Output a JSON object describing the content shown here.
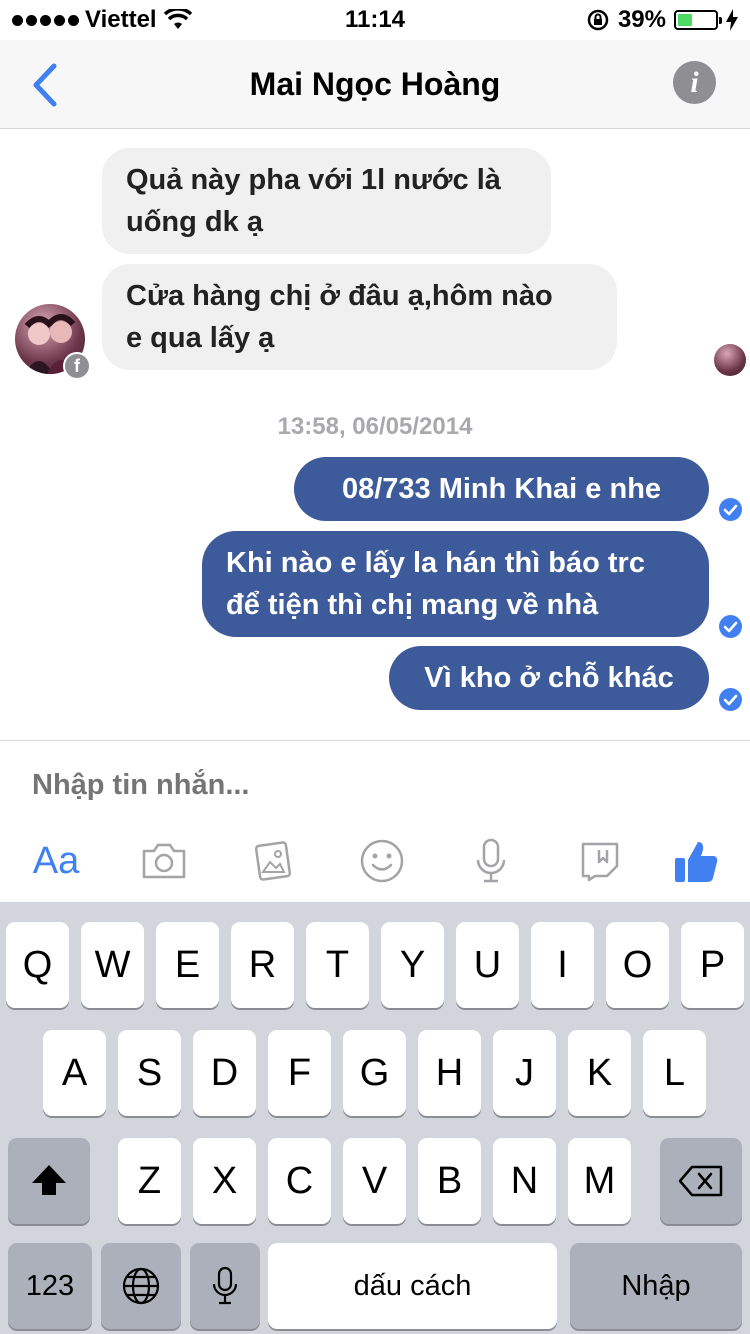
{
  "status_bar": {
    "carrier": "Viettel",
    "time": "11:14",
    "battery_percent": "39%",
    "battery_level": 0.39
  },
  "nav": {
    "title": "Mai Ngọc Hoàng"
  },
  "messages": {
    "incoming": [
      {
        "lines": [
          "Quả này pha với 1l nước là",
          "uống dk ạ"
        ]
      },
      {
        "lines": [
          "Cửa hàng chị ở đâu ạ,hôm nào",
          "e qua lấy ạ"
        ]
      }
    ],
    "timestamp": "13:58, 06/05/2014",
    "outgoing": [
      {
        "lines": [
          "08/733 Minh Khai e nhe"
        ]
      },
      {
        "lines": [
          "Khi nào e lấy la hán thì báo trc",
          "để tiện thì chị mang về nhà"
        ]
      },
      {
        "lines": [
          "Vì kho ở chỗ khác"
        ]
      }
    ]
  },
  "composer": {
    "placeholder": "Nhập tin nhắn...",
    "aa_label": "Aa"
  },
  "keyboard": {
    "row1": [
      "Q",
      "W",
      "E",
      "R",
      "T",
      "Y",
      "U",
      "I",
      "O",
      "P"
    ],
    "row2": [
      "A",
      "S",
      "D",
      "F",
      "G",
      "H",
      "J",
      "K",
      "L"
    ],
    "row3": [
      "Z",
      "X",
      "C",
      "V",
      "B",
      "N",
      "M"
    ],
    "numbers_label": "123",
    "space_label": "dấu cách",
    "return_label": "Nhập"
  },
  "colors": {
    "accent": "#4080f0",
    "outgoing_bubble": "#3d5a9b",
    "incoming_bubble": "#f1f0f0"
  }
}
